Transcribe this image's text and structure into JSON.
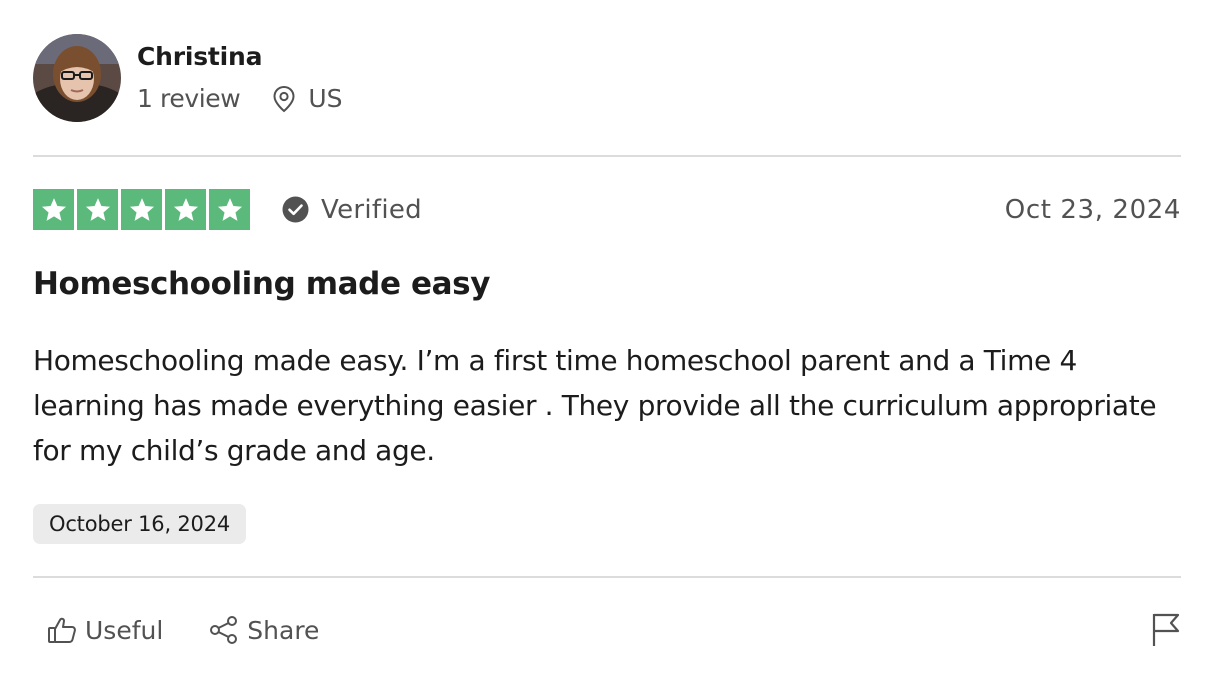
{
  "reviewer": {
    "name": "Christina",
    "review_count": "1 review",
    "location": "US"
  },
  "review": {
    "rating": 5,
    "rating_max": 5,
    "verified_label": "Verified",
    "date": "Oct 23, 2024",
    "title": "Homeschooling made easy",
    "body": "Homeschooling made easy. I’m a first time homeschool parent and a Time 4 learning has made everything easier . They provide all the curriculum appropriate for my child’s grade and age.",
    "experience_date": "October 16, 2024"
  },
  "actions": {
    "useful_label": "Useful",
    "share_label": "Share"
  },
  "icons": {
    "location": "location-pin-icon",
    "verified": "check-circle-icon",
    "useful": "thumbs-up-icon",
    "share": "share-icon",
    "flag": "flag-icon"
  },
  "colors": {
    "star_fill": "#5cb97c",
    "text_primary": "#1c1c1c",
    "text_secondary": "#525252",
    "divider": "#dcdcdc",
    "date_chip": "#ebebeb"
  }
}
